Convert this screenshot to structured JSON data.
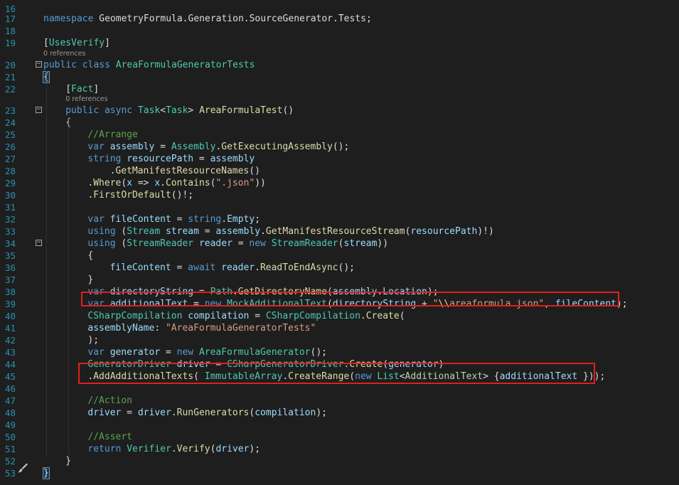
{
  "editor": {
    "reference_label": "0 references",
    "lines": [
      {
        "n": "16",
        "tokens": []
      },
      {
        "n": "17",
        "tokens": [
          [
            "kw",
            "namespace"
          ],
          [
            "plain",
            " GeometryFormula.Generation.SourceGenerator.Tests;"
          ]
        ]
      },
      {
        "n": "18",
        "tokens": []
      },
      {
        "n": "19",
        "tokens": [
          [
            "plain",
            "["
          ],
          [
            "type",
            "UsesVerify"
          ],
          [
            "plain",
            "]"
          ]
        ]
      },
      {
        "n": "20",
        "tokens": [
          [
            "kw",
            "public"
          ],
          [
            "plain",
            " "
          ],
          [
            "kw",
            "class"
          ],
          [
            "plain",
            " "
          ],
          [
            "type",
            "AreaFormulaGeneratorTests"
          ]
        ]
      },
      {
        "n": "21",
        "tokens": [
          [
            "plain",
            "{"
          ]
        ]
      },
      {
        "n": "22",
        "tokens": [
          [
            "plain",
            "["
          ],
          [
            "type",
            "Fact"
          ],
          [
            "plain",
            "]"
          ]
        ]
      },
      {
        "n": "23",
        "tokens": [
          [
            "kw",
            "public"
          ],
          [
            "plain",
            " "
          ],
          [
            "kw",
            "async"
          ],
          [
            "plain",
            " "
          ],
          [
            "type",
            "Task"
          ],
          [
            "plain",
            "<"
          ],
          [
            "type",
            "Task"
          ],
          [
            "plain",
            "> "
          ],
          [
            "method",
            "AreaFormulaTest"
          ],
          [
            "plain",
            "()"
          ]
        ]
      },
      {
        "n": "24",
        "tokens": [
          [
            "plain",
            "{"
          ]
        ]
      },
      {
        "n": "25",
        "tokens": [
          [
            "cmt",
            "//Arrange"
          ]
        ]
      },
      {
        "n": "26",
        "tokens": [
          [
            "kw",
            "var"
          ],
          [
            "plain",
            " "
          ],
          [
            "var",
            "assembly"
          ],
          [
            "plain",
            " = "
          ],
          [
            "type",
            "Assembly"
          ],
          [
            "plain",
            "."
          ],
          [
            "method",
            "GetExecutingAssembly"
          ],
          [
            "plain",
            "();"
          ]
        ]
      },
      {
        "n": "27",
        "tokens": [
          [
            "kw",
            "string"
          ],
          [
            "plain",
            " "
          ],
          [
            "var",
            "resourcePath"
          ],
          [
            "plain",
            " = "
          ],
          [
            "var",
            "assembly"
          ]
        ]
      },
      {
        "n": "28",
        "tokens": [
          [
            "plain",
            "."
          ],
          [
            "method",
            "GetManifestResourceNames"
          ],
          [
            "plain",
            "()"
          ]
        ]
      },
      {
        "n": "29",
        "tokens": [
          [
            "plain",
            "."
          ],
          [
            "method",
            "Where"
          ],
          [
            "plain",
            "("
          ],
          [
            "var",
            "x"
          ],
          [
            "plain",
            " => "
          ],
          [
            "var",
            "x"
          ],
          [
            "plain",
            "."
          ],
          [
            "method",
            "Contains"
          ],
          [
            "plain",
            "("
          ],
          [
            "str",
            "\".json\""
          ],
          [
            "plain",
            "))"
          ]
        ]
      },
      {
        "n": "30",
        "tokens": [
          [
            "plain",
            "."
          ],
          [
            "method",
            "FirstOrDefault"
          ],
          [
            "plain",
            "()!;"
          ]
        ]
      },
      {
        "n": "31",
        "tokens": []
      },
      {
        "n": "32",
        "tokens": [
          [
            "kw",
            "var"
          ],
          [
            "plain",
            " "
          ],
          [
            "var",
            "fileContent"
          ],
          [
            "plain",
            " = "
          ],
          [
            "kw",
            "string"
          ],
          [
            "plain",
            "."
          ],
          [
            "var",
            "Empty"
          ],
          [
            "plain",
            ";"
          ]
        ]
      },
      {
        "n": "33",
        "tokens": [
          [
            "kw",
            "using"
          ],
          [
            "plain",
            " ("
          ],
          [
            "type",
            "Stream"
          ],
          [
            "plain",
            " "
          ],
          [
            "var",
            "stream"
          ],
          [
            "plain",
            " = "
          ],
          [
            "var",
            "assembly"
          ],
          [
            "plain",
            "."
          ],
          [
            "method",
            "GetManifestResourceStream"
          ],
          [
            "plain",
            "("
          ],
          [
            "var",
            "resourcePath"
          ],
          [
            "plain",
            ")!)"
          ]
        ]
      },
      {
        "n": "34",
        "tokens": [
          [
            "kw",
            "using"
          ],
          [
            "plain",
            " ("
          ],
          [
            "type",
            "StreamReader"
          ],
          [
            "plain",
            " "
          ],
          [
            "var",
            "reader"
          ],
          [
            "plain",
            " = "
          ],
          [
            "kw",
            "new"
          ],
          [
            "plain",
            " "
          ],
          [
            "type",
            "StreamReader"
          ],
          [
            "plain",
            "("
          ],
          [
            "var",
            "stream"
          ],
          [
            "plain",
            "))"
          ]
        ]
      },
      {
        "n": "35",
        "tokens": [
          [
            "plain",
            "{"
          ]
        ]
      },
      {
        "n": "36",
        "tokens": [
          [
            "var",
            "fileContent"
          ],
          [
            "plain",
            " = "
          ],
          [
            "kw",
            "await"
          ],
          [
            "plain",
            " "
          ],
          [
            "var",
            "reader"
          ],
          [
            "plain",
            "."
          ],
          [
            "method",
            "ReadToEndAsync"
          ],
          [
            "plain",
            "();"
          ]
        ]
      },
      {
        "n": "37",
        "tokens": [
          [
            "plain",
            "}"
          ]
        ]
      },
      {
        "n": "38",
        "tokens": [
          [
            "kw",
            "var"
          ],
          [
            "plain",
            " "
          ],
          [
            "var",
            "directoryString"
          ],
          [
            "plain",
            " = "
          ],
          [
            "type",
            "Path"
          ],
          [
            "plain",
            "."
          ],
          [
            "method",
            "GetDirectoryName"
          ],
          [
            "plain",
            "("
          ],
          [
            "var",
            "assembly"
          ],
          [
            "plain",
            "."
          ],
          [
            "var",
            "Location"
          ],
          [
            "plain",
            ");"
          ]
        ]
      },
      {
        "n": "39",
        "tokens": [
          [
            "kw",
            "var"
          ],
          [
            "plain",
            " "
          ],
          [
            "var",
            "additionalText"
          ],
          [
            "plain",
            " = "
          ],
          [
            "kw",
            "new"
          ],
          [
            "plain",
            " "
          ],
          [
            "type",
            "MockAdditionalText"
          ],
          [
            "plain",
            "("
          ],
          [
            "var",
            "directoryString"
          ],
          [
            "plain",
            " + "
          ],
          [
            "str",
            "\""
          ],
          [
            "esc",
            "\\\\"
          ],
          [
            "str",
            "areaformula.json\""
          ],
          [
            "plain",
            ", "
          ],
          [
            "var",
            "fileContent"
          ],
          [
            "plain",
            ");"
          ]
        ]
      },
      {
        "n": "40",
        "tokens": [
          [
            "type",
            "CSharpCompilation"
          ],
          [
            "plain",
            " "
          ],
          [
            "var",
            "compilation"
          ],
          [
            "plain",
            " = "
          ],
          [
            "type",
            "CSharpCompilation"
          ],
          [
            "plain",
            "."
          ],
          [
            "method",
            "Create"
          ],
          [
            "plain",
            "("
          ]
        ]
      },
      {
        "n": "41",
        "tokens": [
          [
            "var",
            "assemblyName"
          ],
          [
            "plain",
            ": "
          ],
          [
            "str",
            "\"AreaFormulaGeneratorTests\""
          ]
        ]
      },
      {
        "n": "42",
        "tokens": [
          [
            "plain",
            ");"
          ]
        ]
      },
      {
        "n": "43",
        "tokens": [
          [
            "kw",
            "var"
          ],
          [
            "plain",
            " "
          ],
          [
            "var",
            "generator"
          ],
          [
            "plain",
            " = "
          ],
          [
            "kw",
            "new"
          ],
          [
            "plain",
            " "
          ],
          [
            "type",
            "AreaFormulaGenerator"
          ],
          [
            "plain",
            "();"
          ]
        ]
      },
      {
        "n": "44",
        "tokens": [
          [
            "type",
            "GeneratorDriver"
          ],
          [
            "plain",
            " "
          ],
          [
            "var",
            "driver"
          ],
          [
            "plain",
            " = "
          ],
          [
            "type",
            "CSharpGeneratorDriver"
          ],
          [
            "plain",
            "."
          ],
          [
            "method",
            "Create"
          ],
          [
            "plain",
            "("
          ],
          [
            "var",
            "generator"
          ],
          [
            "plain",
            ")"
          ]
        ]
      },
      {
        "n": "45",
        "tokens": [
          [
            "plain",
            "."
          ],
          [
            "method",
            "AddAdditionalTexts"
          ],
          [
            "plain",
            "( "
          ],
          [
            "type",
            "ImmutableArray"
          ],
          [
            "plain",
            "."
          ],
          [
            "method",
            "CreateRange"
          ],
          [
            "plain",
            "("
          ],
          [
            "kw",
            "new"
          ],
          [
            "plain",
            " "
          ],
          [
            "type",
            "List"
          ],
          [
            "plain",
            "<"
          ],
          [
            "iface",
            "AdditionalText"
          ],
          [
            "plain",
            "> {"
          ],
          [
            "var",
            "additionalText"
          ],
          [
            "plain",
            " }));"
          ]
        ]
      },
      {
        "n": "46",
        "tokens": []
      },
      {
        "n": "47",
        "tokens": [
          [
            "cmt",
            "//Action"
          ]
        ]
      },
      {
        "n": "48",
        "tokens": [
          [
            "var",
            "driver"
          ],
          [
            "plain",
            " = "
          ],
          [
            "var",
            "driver"
          ],
          [
            "plain",
            "."
          ],
          [
            "method",
            "RunGenerators"
          ],
          [
            "plain",
            "("
          ],
          [
            "var",
            "compilation"
          ],
          [
            "plain",
            ");"
          ]
        ]
      },
      {
        "n": "49",
        "tokens": []
      },
      {
        "n": "50",
        "tokens": [
          [
            "cmt",
            "//Assert"
          ]
        ]
      },
      {
        "n": "51",
        "tokens": [
          [
            "kw",
            "return"
          ],
          [
            "plain",
            " "
          ],
          [
            "type",
            "Verifier"
          ],
          [
            "plain",
            "."
          ],
          [
            "method",
            "Verify"
          ],
          [
            "plain",
            "("
          ],
          [
            "var",
            "driver"
          ],
          [
            "plain",
            ");"
          ]
        ]
      },
      {
        "n": "52",
        "tokens": [
          [
            "plain",
            "}"
          ]
        ]
      },
      {
        "n": "53",
        "tokens": [
          [
            "plain",
            "}"
          ]
        ]
      }
    ]
  }
}
